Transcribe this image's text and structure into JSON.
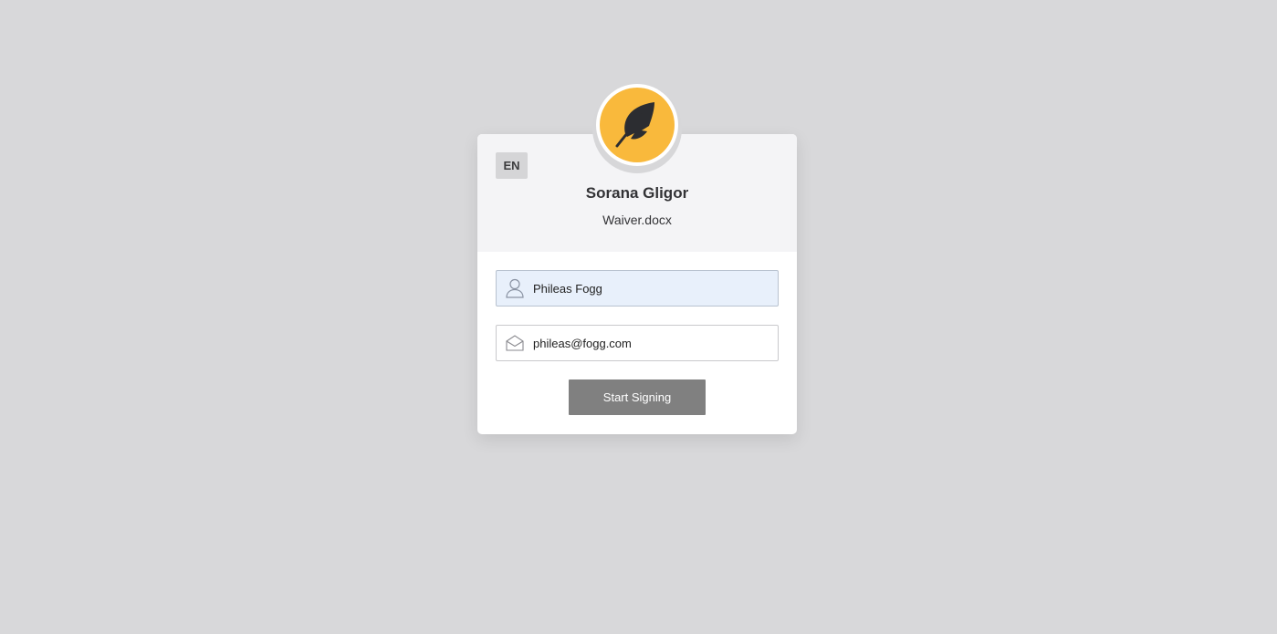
{
  "header": {
    "language_badge": "EN",
    "sender_name": "Sorana Gligor",
    "document_name": "Waiver.docx",
    "avatar_icon": "feather-icon"
  },
  "form": {
    "name_value": "Phileas Fogg",
    "name_icon": "person-icon",
    "email_value": "phileas@fogg.com",
    "email_icon": "envelope-icon",
    "submit_label": "Start Signing"
  },
  "colors": {
    "background": "#d8d8da",
    "avatar_accent": "#f9b93c",
    "button": "#808080",
    "filled_field": "#e8f0fb"
  }
}
